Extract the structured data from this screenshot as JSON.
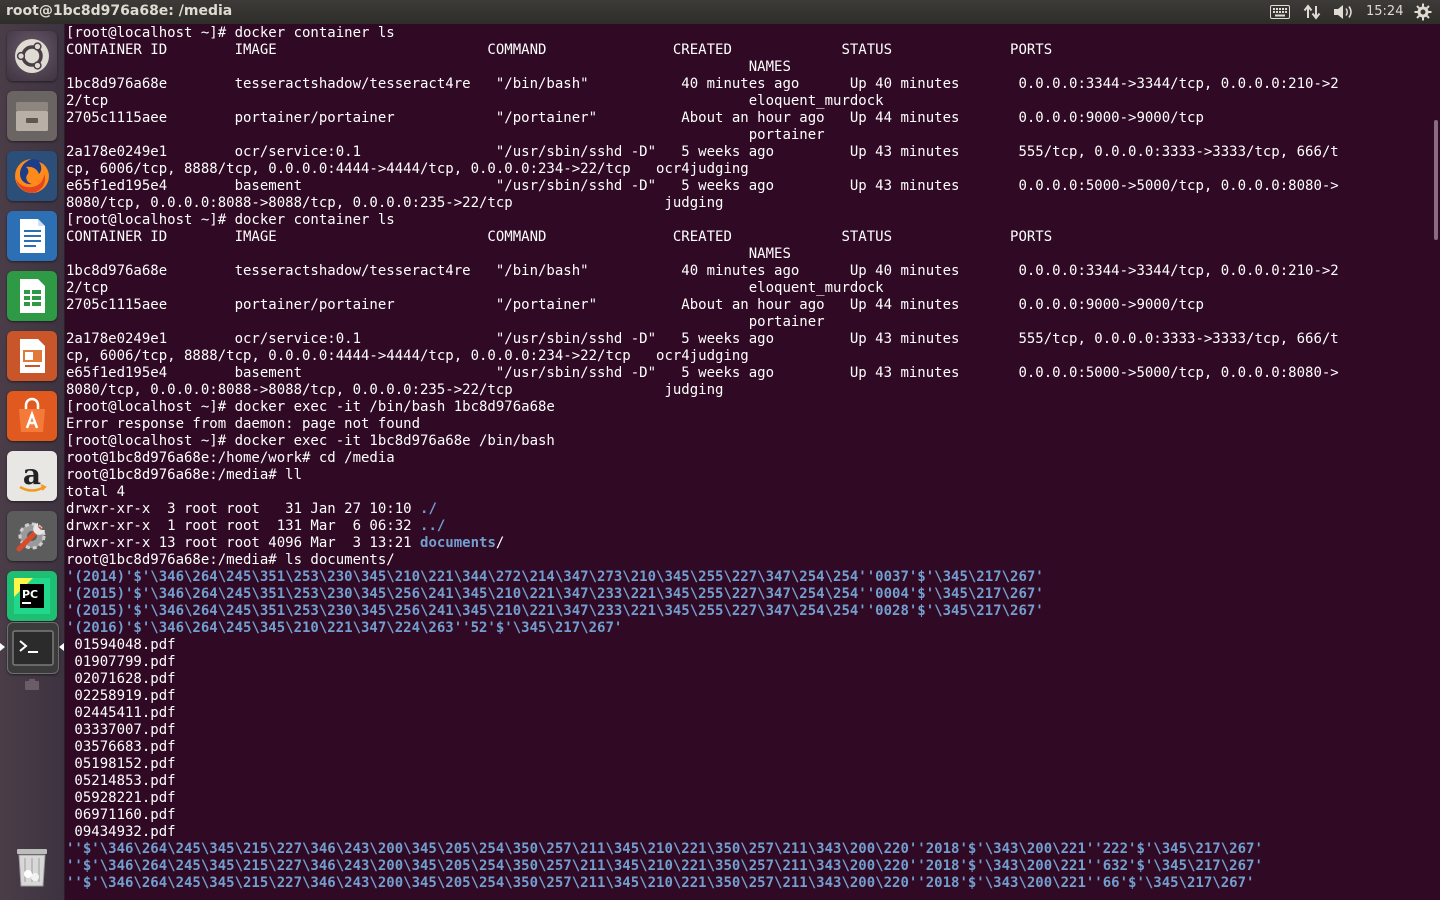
{
  "window": {
    "title": "root@1bc8d976a68e: /media"
  },
  "panel": {
    "clock": "15:24",
    "tray_icons": [
      "keyboard-icon",
      "network-arrows-icon",
      "volume-icon",
      "settings-gear-icon"
    ]
  },
  "launcher": {
    "items": [
      {
        "name": "ubuntu-dash",
        "icon": "ubuntu-logo-icon"
      },
      {
        "name": "files",
        "icon": "file-cabinet-icon"
      },
      {
        "name": "firefox",
        "icon": "firefox-icon"
      },
      {
        "name": "libreoffice-writer",
        "icon": "writer-document-icon"
      },
      {
        "name": "libreoffice-calc",
        "icon": "calc-spreadsheet-icon"
      },
      {
        "name": "libreoffice-impress",
        "icon": "impress-presentation-icon"
      },
      {
        "name": "ubuntu-software",
        "icon": "software-bag-icon"
      },
      {
        "name": "amazon",
        "icon": "amazon-icon"
      },
      {
        "name": "system-settings",
        "icon": "wrench-settings-icon"
      },
      {
        "name": "pycharm",
        "icon": "pycharm-icon"
      },
      {
        "name": "terminal",
        "icon": "terminal-icon"
      },
      {
        "name": "trash",
        "icon": "trash-icon"
      }
    ],
    "colors": {
      "background": "#403541",
      "active_pip": "#ffffff"
    }
  },
  "terminal": {
    "colors": {
      "background": "#300a24",
      "foreground": "#ffffff",
      "directory": "#729fcf"
    },
    "lines": [
      {
        "text": "[root@localhost ~]# docker container ls"
      },
      {
        "text": "CONTAINER ID        IMAGE                         COMMAND               CREATED             STATUS              PORTS"
      },
      {
        "text": "                                                                                 NAMES"
      },
      {
        "text": "1bc8d976a68e        tesseractshadow/tesseract4re   \"/bin/bash\"           40 minutes ago      Up 40 minutes       0.0.0.0:3344->3344/tcp, 0.0.0.0:210->2"
      },
      {
        "text": "2/tcp                                                                            eloquent_murdock"
      },
      {
        "text": "2705c1115aee        portainer/portainer            \"/portainer\"          About an hour ago   Up 44 minutes       0.0.0.0:9000->9000/tcp"
      },
      {
        "text": "                                                                                 portainer"
      },
      {
        "text": "2a178e0249e1        ocr/service:0.1                \"/usr/sbin/sshd -D\"   5 weeks ago         Up 43 minutes       555/tcp, 0.0.0.0:3333->3333/tcp, 666/t"
      },
      {
        "text": "cp, 6006/tcp, 8888/tcp, 0.0.0.0:4444->4444/tcp, 0.0.0.0:234->22/tcp   ocr4judging"
      },
      {
        "text": "e65f1ed195e4        basement                       \"/usr/sbin/sshd -D\"   5 weeks ago         Up 43 minutes       0.0.0.0:5000->5000/tcp, 0.0.0.0:8080->"
      },
      {
        "text": "8080/tcp, 0.0.0.0:8088->8088/tcp, 0.0.0.0:235->22/tcp                  judging"
      },
      {
        "text": "[root@localhost ~]# docker container ls"
      },
      {
        "text": "CONTAINER ID        IMAGE                         COMMAND               CREATED             STATUS              PORTS"
      },
      {
        "text": "                                                                                 NAMES"
      },
      {
        "text": "1bc8d976a68e        tesseractshadow/tesseract4re   \"/bin/bash\"           40 minutes ago      Up 40 minutes       0.0.0.0:3344->3344/tcp, 0.0.0.0:210->2"
      },
      {
        "text": "2/tcp                                                                            eloquent_murdock"
      },
      {
        "text": "2705c1115aee        portainer/portainer            \"/portainer\"          About an hour ago   Up 44 minutes       0.0.0.0:9000->9000/tcp"
      },
      {
        "text": "                                                                                 portainer"
      },
      {
        "text": "2a178e0249e1        ocr/service:0.1                \"/usr/sbin/sshd -D\"   5 weeks ago         Up 43 minutes       555/tcp, 0.0.0.0:3333->3333/tcp, 666/t"
      },
      {
        "text": "cp, 6006/tcp, 8888/tcp, 0.0.0.0:4444->4444/tcp, 0.0.0.0:234->22/tcp   ocr4judging"
      },
      {
        "text": "e65f1ed195e4        basement                       \"/usr/sbin/sshd -D\"   5 weeks ago         Up 43 minutes       0.0.0.0:5000->5000/tcp, 0.0.0.0:8080->"
      },
      {
        "text": "8080/tcp, 0.0.0.0:8088->8088/tcp, 0.0.0.0:235->22/tcp                  judging"
      },
      {
        "text": "[root@localhost ~]# docker exec -it /bin/bash 1bc8d976a68e"
      },
      {
        "text": "Error response from daemon: page not found"
      },
      {
        "text": "[root@localhost ~]# docker exec -it 1bc8d976a68e /bin/bash"
      },
      {
        "text": "root@1bc8d976a68e:/home/work# cd /media"
      },
      {
        "text": "root@1bc8d976a68e:/media# ll"
      },
      {
        "text": "total 4"
      },
      {
        "text": "drwxr-xr-x  3 root root   31 Jan 27 10:10 ",
        "dir": "./"
      },
      {
        "text": "drwxr-xr-x  1 root root  131 Mar  6 06:32 ",
        "dir": "../"
      },
      {
        "text": "drwxr-xr-x 13 root root 4096 Mar  3 13:21 ",
        "dir": "documents",
        "suffix": "/"
      },
      {
        "text": "root@1bc8d976a68e:/media# ls documents/"
      },
      {
        "blue": "'(2014)'$'\\346\\264\\245\\351\\253\\230\\345\\210\\221\\344\\272\\214\\347\\273\\210\\345\\255\\227\\347\\254\\254''0037'$'\\345\\217\\267'"
      },
      {
        "blue": "'(2015)'$'\\346\\264\\245\\351\\253\\230\\345\\256\\241\\345\\210\\221\\347\\233\\221\\345\\255\\227\\347\\254\\254''0004'$'\\345\\217\\267'"
      },
      {
        "blue": "'(2015)'$'\\346\\264\\245\\351\\253\\230\\345\\256\\241\\345\\210\\221\\347\\233\\221\\345\\255\\227\\347\\254\\254''0028'$'\\345\\217\\267'"
      },
      {
        "blue": "'(2016)'$'\\346\\264\\245\\345\\210\\221\\347\\224\\263''52'$'\\345\\217\\267'"
      },
      {
        "text": " 01594048.pdf"
      },
      {
        "text": " 01907799.pdf"
      },
      {
        "text": " 02071628.pdf"
      },
      {
        "text": " 02258919.pdf"
      },
      {
        "text": " 02445411.pdf"
      },
      {
        "text": " 03337007.pdf"
      },
      {
        "text": " 03576683.pdf"
      },
      {
        "text": " 05198152.pdf"
      },
      {
        "text": " 05214853.pdf"
      },
      {
        "text": " 05928221.pdf"
      },
      {
        "text": " 06971160.pdf"
      },
      {
        "text": " 09434932.pdf"
      },
      {
        "blue": "''$'\\346\\264\\245\\345\\215\\227\\346\\243\\200\\345\\205\\254\\350\\257\\211\\345\\210\\221\\350\\257\\211\\343\\200\\220''2018'$'\\343\\200\\221''222'$'\\345\\217\\267'"
      },
      {
        "blue": "''$'\\346\\264\\245\\345\\215\\227\\346\\243\\200\\345\\205\\254\\350\\257\\211\\345\\210\\221\\350\\257\\211\\343\\200\\220''2018'$'\\343\\200\\221''632'$'\\345\\217\\267'"
      },
      {
        "blue": "''$'\\346\\264\\245\\345\\215\\227\\346\\243\\200\\345\\205\\254\\350\\257\\211\\345\\210\\221\\350\\257\\211\\343\\200\\220''2018'$'\\343\\200\\221''66'$'\\345\\217\\267'"
      }
    ]
  }
}
